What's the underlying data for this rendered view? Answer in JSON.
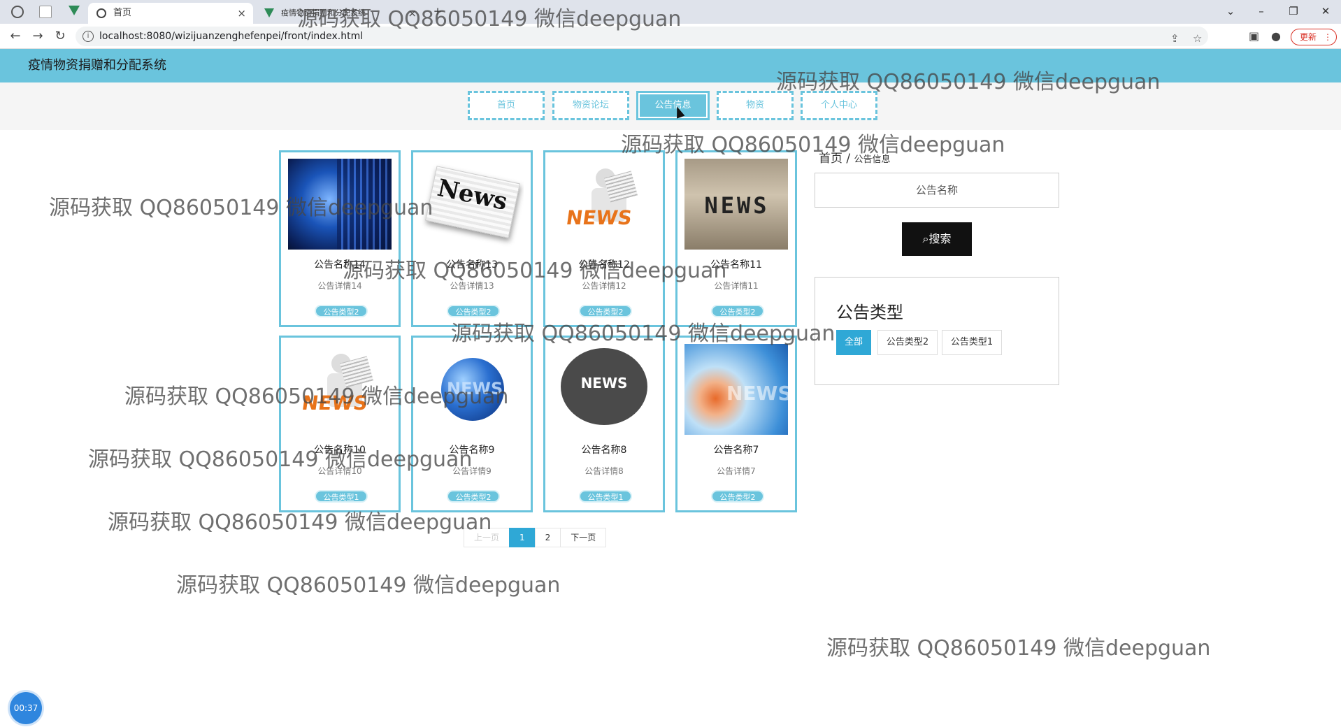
{
  "browser": {
    "tabs": [
      {
        "title": "首页",
        "active": true
      },
      {
        "title": "疫情物资捐赠和分配系统",
        "active": false
      }
    ],
    "new_tab": "+",
    "url": "localhost:8080/wizijuanzenghefenpei/front/index.html",
    "update_label": "更新"
  },
  "site": {
    "title": "疫情物资捐赠和分配系统",
    "menu": [
      "首页",
      "物资论坛",
      "公告信息",
      "物资",
      "个人中心"
    ],
    "active_menu": "公告信息"
  },
  "cards": [
    {
      "name": "公告名称14",
      "detail": "公告详情14",
      "type": "公告类型2",
      "image": "globe-news-image"
    },
    {
      "name": "公告名称13",
      "detail": "公告详情13",
      "type": "公告类型2",
      "image": "newspaper-image",
      "label": "News"
    },
    {
      "name": "公告名称12",
      "detail": "公告详情12",
      "type": "公告类型2",
      "image": "reader-news-image",
      "label": "NEWS"
    },
    {
      "name": "公告名称11",
      "detail": "公告详情11",
      "type": "公告类型2",
      "image": "news-blocks-image",
      "label": "NEWS"
    },
    {
      "name": "公告名称10",
      "detail": "公告详情10",
      "type": "公告类型1",
      "image": "reader-news-image",
      "label": "NEWS"
    },
    {
      "name": "公告名称9",
      "detail": "公告详情9",
      "type": "公告类型2",
      "image": "globe-news-image",
      "label": "NEWS"
    },
    {
      "name": "公告名称8",
      "detail": "公告详情8",
      "type": "公告类型1",
      "image": "news-circle-image",
      "label": "NEWS"
    },
    {
      "name": "公告名称7",
      "detail": "公告详情7",
      "type": "公告类型2",
      "image": "blue-news-image",
      "label": "NEWS"
    }
  ],
  "pagination": {
    "prev": "上一页",
    "pages": [
      "1",
      "2"
    ],
    "current": "1",
    "next": "下一页"
  },
  "sidebar": {
    "breadcrumb_home": "首页",
    "breadcrumb_sep": "/",
    "breadcrumb_current": "公告信息",
    "search_placeholder": "公告名称",
    "search_button": "搜索",
    "type_title": "公告类型",
    "types": [
      "全部",
      "公告类型2",
      "公告类型1"
    ],
    "active_type": "全部"
  },
  "timer": "00:37",
  "watermark": "源码获取 QQ86050149 微信deepguan",
  "colors": {
    "accent": "#6ac4dd",
    "primary": "#2fa8d6",
    "dark": "#111111"
  }
}
